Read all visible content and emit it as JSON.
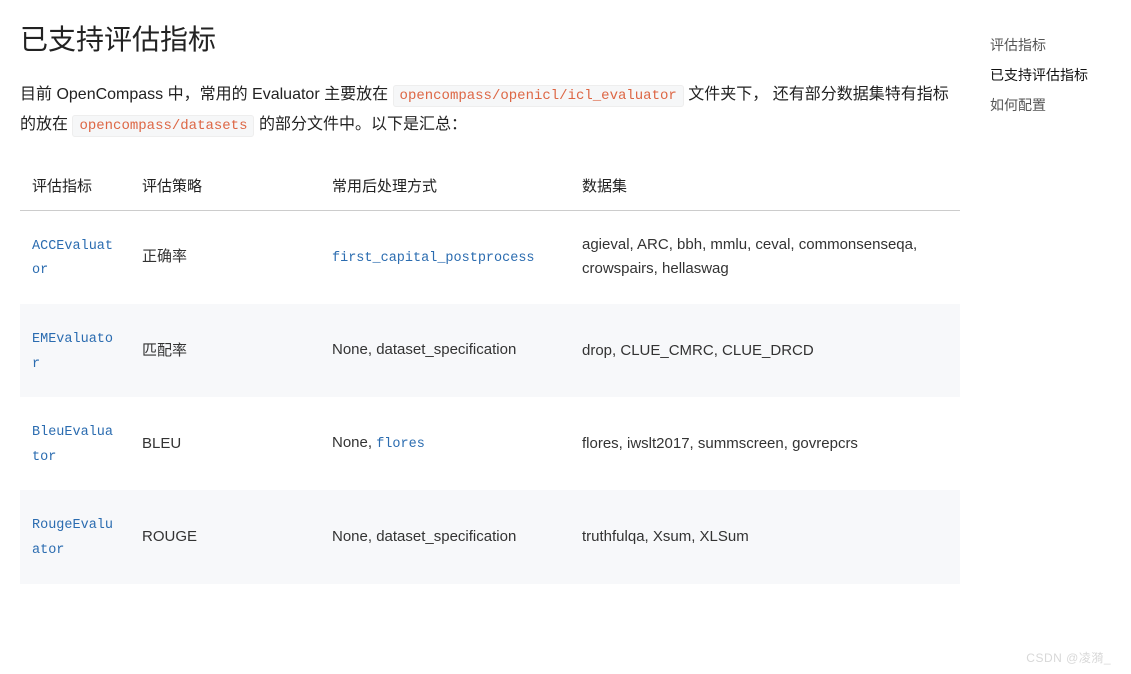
{
  "heading": "已支持评估指标",
  "intro": {
    "p1a": "目前 OpenCompass 中，常用的 Evaluator 主要放在 ",
    "code1": "opencompass/openicl/icl_evaluator",
    "p1b": " 文件夹下， 还有部分数据集特有指标的放在 ",
    "code2": "opencompass/datasets",
    "p1c": " 的部分文件中。以下是汇总："
  },
  "table": {
    "headers": {
      "c1": "评估指标",
      "c2": "评估策略",
      "c3": "常用后处理方式",
      "c4": "数据集"
    },
    "rows": [
      {
        "evaluator": "ACCEvaluator",
        "strategy": "正确率",
        "post_prefix": "",
        "post_link": "first_capital_postprocess",
        "post_suffix": "",
        "datasets": "agieval, ARC, bbh, mmlu, ceval, commonsenseqa, crowspairs, hellaswag"
      },
      {
        "evaluator": "EMEvaluator",
        "strategy": "匹配率",
        "post_prefix": "None, dataset_specification",
        "post_link": "",
        "post_suffix": "",
        "datasets": "drop, CLUE_CMRC, CLUE_DRCD"
      },
      {
        "evaluator": "BleuEvaluator",
        "strategy": "BLEU",
        "post_prefix": "None, ",
        "post_link": "flores",
        "post_suffix": "",
        "datasets": "flores, iwslt2017, summscreen, govrepcrs"
      },
      {
        "evaluator": "RougeEvaluator",
        "strategy": "ROUGE",
        "post_prefix": "None, dataset_specification",
        "post_link": "",
        "post_suffix": "",
        "datasets": "truthfulqa, Xsum, XLSum"
      }
    ]
  },
  "sidebar": {
    "items": [
      {
        "label": "评估指标",
        "active": false
      },
      {
        "label": "已支持评估指标",
        "active": true
      },
      {
        "label": "如何配置",
        "active": false
      }
    ]
  },
  "watermark": "CSDN @凌漪_"
}
